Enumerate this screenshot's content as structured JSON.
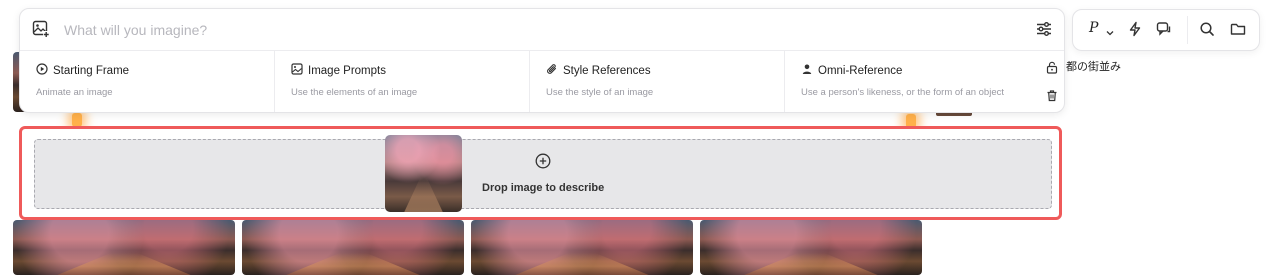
{
  "prompt": {
    "placeholder": "What will you imagine?",
    "leading_icon": "image-add-icon",
    "trailing_icon": "settings-sliders-icon"
  },
  "options": [
    {
      "icon": "play-circle-icon",
      "title": "Starting Frame",
      "subtitle": "Animate an image"
    },
    {
      "icon": "image-grid-icon",
      "title": "Image Prompts",
      "subtitle": "Use the elements of an image"
    },
    {
      "icon": "paperclip-icon",
      "title": "Style References",
      "subtitle": "Use the style of an image"
    },
    {
      "icon": "person-icon",
      "title": "Omni-Reference",
      "subtitle": "Use a person's likeness, or the form of an object"
    }
  ],
  "toolbar": {
    "personalize_label": "P",
    "icons": [
      "chevron-down-icon",
      "bolt-icon",
      "chat-icon",
      "search-icon",
      "folder-icon"
    ]
  },
  "side_icons": [
    "lock-icon",
    "trash-icon"
  ],
  "background_caption": "都の街並み",
  "drop_zone": {
    "label": "Drop image to describe",
    "icon": "plus-circle-icon",
    "highlight_color": "#ef5a5a"
  }
}
